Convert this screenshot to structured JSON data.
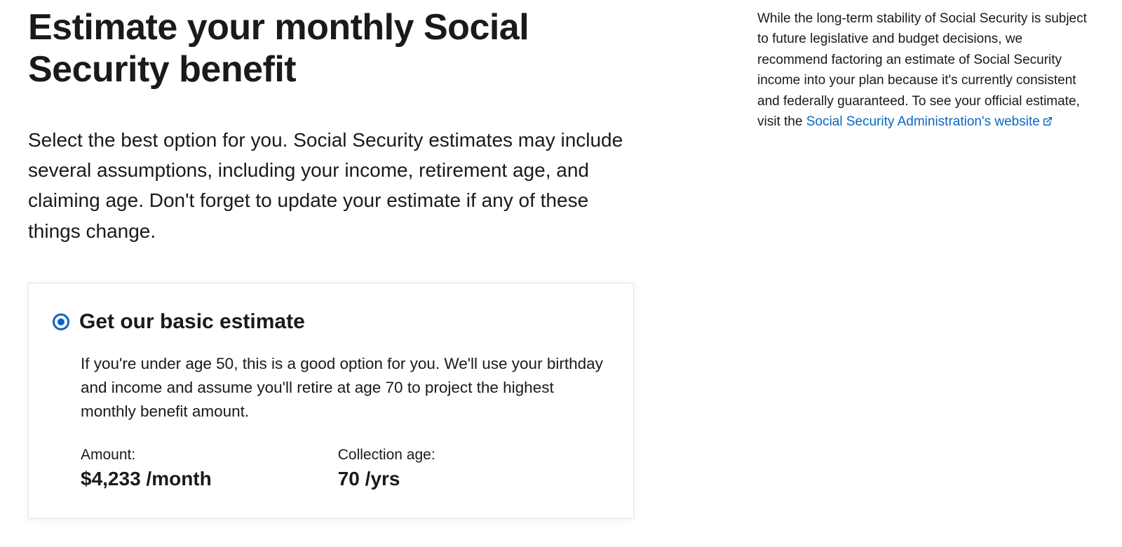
{
  "main": {
    "title": "Estimate your monthly Social Security benefit",
    "subtitle": "Select the best option for you. Social Security estimates may include several assumptions, including your income, retirement age, and claiming age. Don't forget to update your estimate if any of these things change.",
    "option": {
      "title": "Get our basic estimate",
      "description": "If you're under age 50, this is a good option for you. We'll use your birthday and income and assume you'll retire at age 70 to project the highest monthly benefit amount.",
      "amount_label": "Amount:",
      "amount_value": "$4,233 /month",
      "age_label": "Collection age:",
      "age_value": "70 /yrs"
    }
  },
  "aside": {
    "text_before_link": "While the long-term stability of Social Security is subject to future legislative and budget decisions, we recommend factoring an estimate of Social Security income into your plan because it's currently consistent and federally guaranteed. To see your official estimate, visit the ",
    "link_text": "Social Security Administration's website"
  }
}
